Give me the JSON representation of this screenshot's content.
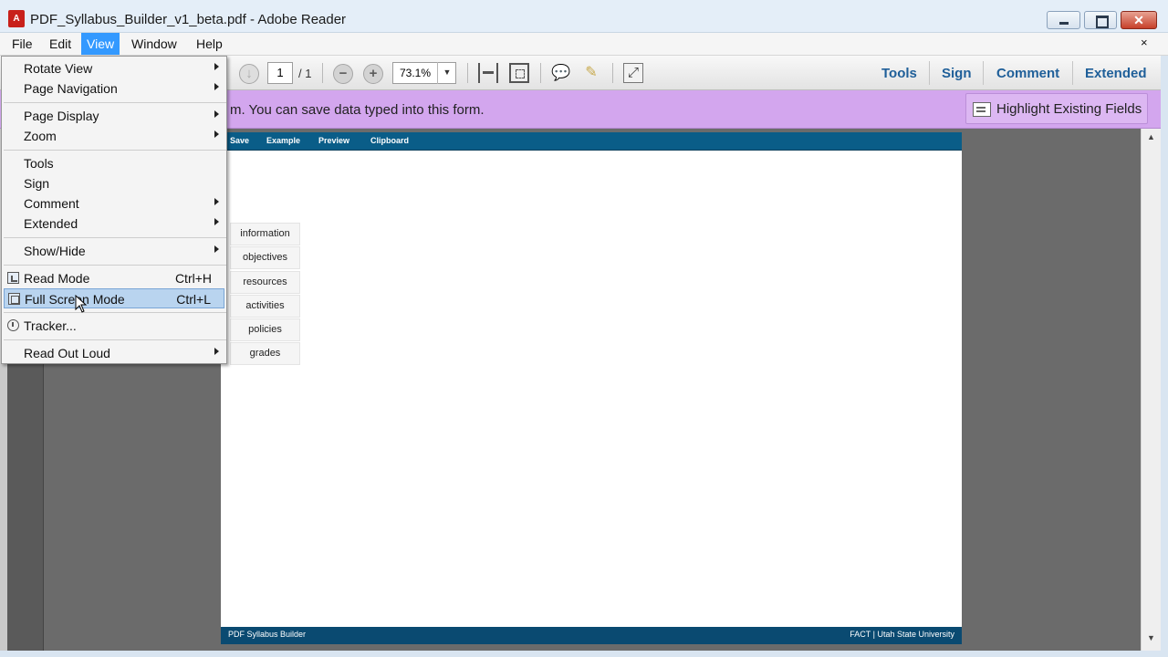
{
  "window": {
    "title": "PDF_Syllabus_Builder_v1_beta.pdf - Adobe Reader",
    "app_icon": "adobe-reader-icon",
    "close_glyph": "✕"
  },
  "menubar": {
    "items": [
      "File",
      "Edit",
      "View",
      "Window",
      "Help"
    ],
    "active": "View",
    "doc_close": "×"
  },
  "toolbar": {
    "page_current": "1",
    "page_total": "/ 1",
    "zoom": "73.1%",
    "zoom_out_glyph": "−",
    "zoom_in_glyph": "+",
    "zoom_arrow_glyph": "▼",
    "comment_glyph": "💬",
    "sign_glyph": "✎",
    "expand_glyph": "⤢",
    "links": [
      "Tools",
      "Sign",
      "Comment",
      "Extended"
    ]
  },
  "infobar": {
    "text": "m. You can save data typed into this form.",
    "highlight_button": "Highlight Existing Fields"
  },
  "view_menu": {
    "items": [
      {
        "label": "Rotate View",
        "submenu": true
      },
      {
        "label": "Page Navigation",
        "submenu": true
      },
      {
        "label": "Page Display",
        "submenu": true
      },
      {
        "label": "Zoom",
        "submenu": true
      },
      {
        "label": "Tools",
        "submenu": false
      },
      {
        "label": "Sign",
        "submenu": false
      },
      {
        "label": "Comment",
        "submenu": true
      },
      {
        "label": "Extended",
        "submenu": true
      },
      {
        "label": "Show/Hide",
        "submenu": true
      },
      {
        "label": "Read Mode",
        "shortcut": "Ctrl+H",
        "icon": "read-mode-icon"
      },
      {
        "label": "Full Screen Mode",
        "shortcut": "Ctrl+L",
        "icon": "full-screen-icon",
        "highlighted": true
      },
      {
        "label": "Tracker...",
        "icon": "tracker-icon"
      },
      {
        "label": "Read Out Loud",
        "submenu": true
      }
    ]
  },
  "pdf": {
    "header_nav": [
      "Save",
      "Example",
      "Preview",
      "Clipboard"
    ],
    "side_tabs": [
      "information",
      "objectives",
      "resources",
      "activities",
      "policies",
      "grades"
    ],
    "footer_left": "PDF Syllabus Builder",
    "footer_right": "FACT | Utah State University"
  },
  "scrollbar": {
    "up_glyph": "▲",
    "down_glyph": "▼"
  },
  "colors": {
    "menu_active": "#3399ff",
    "infobar": "#d3a6ee",
    "pdf_header": "#0a5d88",
    "toolbar_link": "#1f5f99"
  }
}
